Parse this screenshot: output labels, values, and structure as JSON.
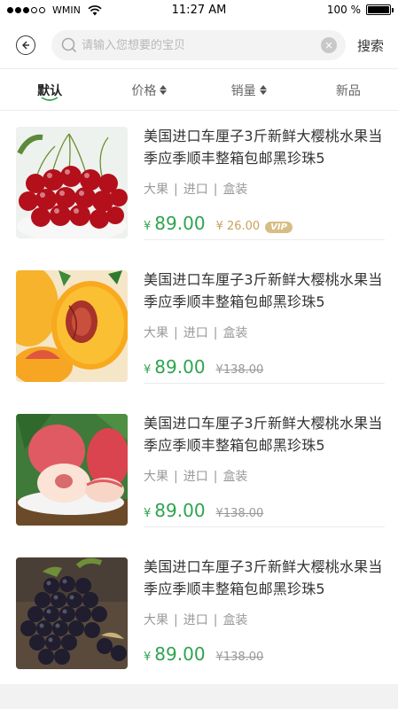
{
  "status_bar": {
    "carrier": "WMIN",
    "time": "11:27 AM",
    "battery": "100 %",
    "battery_level": 1.0
  },
  "header": {
    "back_icon": "back-circle-icon",
    "search_placeholder": "请输入您想要的宝贝",
    "search_value": "",
    "clear_icon": "×",
    "search_button": "搜索"
  },
  "sort_tabs": [
    {
      "label": "默认",
      "active": true
    },
    {
      "label": "价格",
      "active": false,
      "sortable": true
    },
    {
      "label": "销量",
      "active": false,
      "sortable": true
    },
    {
      "label": "新品",
      "active": false
    }
  ],
  "products": [
    {
      "image": "cherries",
      "title": "美国进口车厘子3斤新鲜大樱桃水果当季应季顺丰整箱包邮黑珍珠5",
      "tags": [
        "大果",
        "进口",
        "盒装"
      ],
      "currency": "¥",
      "price": "89.00",
      "vip_price": "¥ 26.00",
      "vip_label": "VIP",
      "old_price": ""
    },
    {
      "image": "yellow-peach",
      "title": "美国进口车厘子3斤新鲜大樱桃水果当季应季顺丰整箱包邮黑珍珠5",
      "tags": [
        "大果",
        "进口",
        "盒装"
      ],
      "currency": "¥",
      "price": "89.00",
      "vip_price": "",
      "vip_label": "",
      "old_price": "¥138.00"
    },
    {
      "image": "white-peach",
      "title": "美国进口车厘子3斤新鲜大樱桃水果当季应季顺丰整箱包邮黑珍珠5",
      "tags": [
        "大果",
        "进口",
        "盒装"
      ],
      "currency": "¥",
      "price": "89.00",
      "vip_price": "",
      "vip_label": "",
      "old_price": "¥138.00"
    },
    {
      "image": "grapes",
      "title": "美国进口车厘子3斤新鲜大樱桃水果当季应季顺丰整箱包邮黑珍珠5",
      "tags": [
        "大果",
        "进口",
        "盒装"
      ],
      "currency": "¥",
      "price": "89.00",
      "vip_price": "",
      "vip_label": "",
      "old_price": "¥138.00"
    }
  ],
  "colors": {
    "price_green": "#2ea44f",
    "vip_gold": "#c9a25a",
    "divider": "#ececec"
  }
}
